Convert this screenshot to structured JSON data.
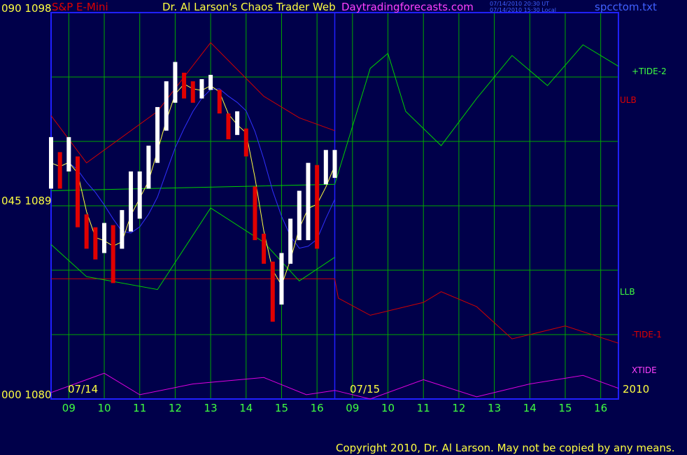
{
  "header": {
    "symbol": "S&P E-Mini",
    "title": "Dr. Al Larson's Chaos Trader Web",
    "site": "Daytradingforecasts.com",
    "time_ut": "07/14/2010 20:30 UT",
    "time_local": "07/14/2010 15:30 Local",
    "filename": "spcctom.txt"
  },
  "axis_left": {
    "top": "090  1098",
    "mid": "045  1089",
    "bottom": "000  1080"
  },
  "footer": {
    "copyright": "Copyright 2010, Dr. Al Larson. May not be copied by any means."
  },
  "colors": {
    "background": "#00004a",
    "grid": "#00a800",
    "frame": "#2020ff",
    "upper_band": "#d00000",
    "lower_band": "#00d000",
    "forecast_plus": "#00d000",
    "forecast_minus": "#d00000",
    "xtide": "#e000e0",
    "moving_avg": "#ffff40",
    "slow_avg": "#3030ff"
  },
  "chart_data": {
    "type": "line",
    "title": "S&P E-Mini",
    "ylim": [
      1080,
      1098
    ],
    "y_ticks": [
      1080,
      1089,
      1098
    ],
    "x_hours": [
      "09",
      "10",
      "11",
      "12",
      "13",
      "14",
      "15",
      "16",
      "09",
      "10",
      "11",
      "12",
      "13",
      "14",
      "15",
      "16"
    ],
    "date_labels": [
      "07/14",
      "07/15",
      "2010"
    ],
    "series": [
      {
        "name": "+TIDE-2",
        "points": [
          [
            0,
            1089.7
          ],
          [
            8,
            1090
          ],
          [
            9,
            1095.4
          ],
          [
            9.5,
            1096.1
          ],
          [
            10,
            1093.4
          ],
          [
            11,
            1091.8
          ],
          [
            12,
            1094
          ],
          [
            13,
            1096
          ],
          [
            14,
            1094.6
          ],
          [
            15,
            1096.5
          ],
          [
            16,
            1095.5
          ]
        ]
      },
      {
        "name": "-TIDE-1",
        "points": [
          [
            0,
            1085.6
          ],
          [
            8,
            1085.6
          ],
          [
            8.1,
            1084.7
          ],
          [
            9,
            1083.9
          ],
          [
            10.5,
            1084.5
          ],
          [
            11,
            1085
          ],
          [
            12,
            1084.3
          ],
          [
            13,
            1082.8
          ],
          [
            14.5,
            1083.4
          ],
          [
            16,
            1082.6
          ]
        ]
      },
      {
        "name": "XTIDE",
        "points": [
          [
            0,
            1080.3
          ],
          [
            1.5,
            1081.2
          ],
          [
            2.5,
            1080.2
          ],
          [
            4,
            1080.7
          ],
          [
            6,
            1081
          ],
          [
            7.2,
            1080.2
          ],
          [
            8,
            1080.4
          ],
          [
            9,
            1080
          ],
          [
            10.5,
            1080.9
          ],
          [
            12,
            1080.1
          ],
          [
            13.5,
            1080.7
          ],
          [
            15,
            1081.1
          ],
          [
            16,
            1080.5
          ]
        ]
      },
      {
        "name": "ULB",
        "points": [
          [
            0,
            1093.2
          ],
          [
            1,
            1091
          ],
          [
            3,
            1093.4
          ],
          [
            4.5,
            1096.6
          ],
          [
            6,
            1094.1
          ],
          [
            7,
            1093.1
          ],
          [
            8,
            1092.5
          ]
        ]
      },
      {
        "name": "LLB",
        "points": [
          [
            0,
            1087.2
          ],
          [
            1,
            1085.7
          ],
          [
            3,
            1085.1
          ],
          [
            4.5,
            1088.9
          ],
          [
            6,
            1087.3
          ],
          [
            7,
            1085.5
          ],
          [
            8,
            1086.6
          ]
        ]
      }
    ],
    "price_bars": [
      [
        0,
        1089.8,
        1092.2
      ],
      [
        0.25,
        1089.8,
        1091.5
      ],
      [
        0.5,
        1090.6,
        1092.2
      ],
      [
        0.75,
        1088,
        1091.3
      ],
      [
        1,
        1087,
        1088.6
      ],
      [
        1.25,
        1086.5,
        1088
      ],
      [
        1.5,
        1086.8,
        1088.2
      ],
      [
        1.75,
        1085.4,
        1088.1
      ],
      [
        2,
        1087,
        1088.8
      ],
      [
        2.25,
        1087.8,
        1090.6
      ],
      [
        2.5,
        1088.4,
        1090.6
      ],
      [
        2.75,
        1089.8,
        1091.8
      ],
      [
        3,
        1091,
        1093.6
      ],
      [
        3.25,
        1092.5,
        1094.8
      ],
      [
        3.5,
        1093.8,
        1095.7
      ],
      [
        3.75,
        1094,
        1095.2
      ],
      [
        4,
        1093.8,
        1094.8
      ],
      [
        4.25,
        1094,
        1094.9
      ],
      [
        4.5,
        1094.4,
        1095.1
      ],
      [
        4.75,
        1093.3,
        1094.4
      ],
      [
        5,
        1092.1,
        1093.3
      ],
      [
        5.25,
        1092.3,
        1093.4
      ],
      [
        5.5,
        1091.3,
        1092.6
      ],
      [
        5.75,
        1087.4,
        1089.9
      ],
      [
        6,
        1086.3,
        1087.7
      ],
      [
        6.25,
        1083.6,
        1086.4
      ],
      [
        6.5,
        1084.4,
        1086.8
      ],
      [
        6.75,
        1086.3,
        1088.4
      ],
      [
        7,
        1087.4,
        1089.7
      ],
      [
        7.25,
        1087.4,
        1091
      ],
      [
        7.5,
        1087,
        1090.9
      ],
      [
        7.75,
        1090,
        1091.6
      ],
      [
        8,
        1090.3,
        1091.6
      ]
    ]
  }
}
